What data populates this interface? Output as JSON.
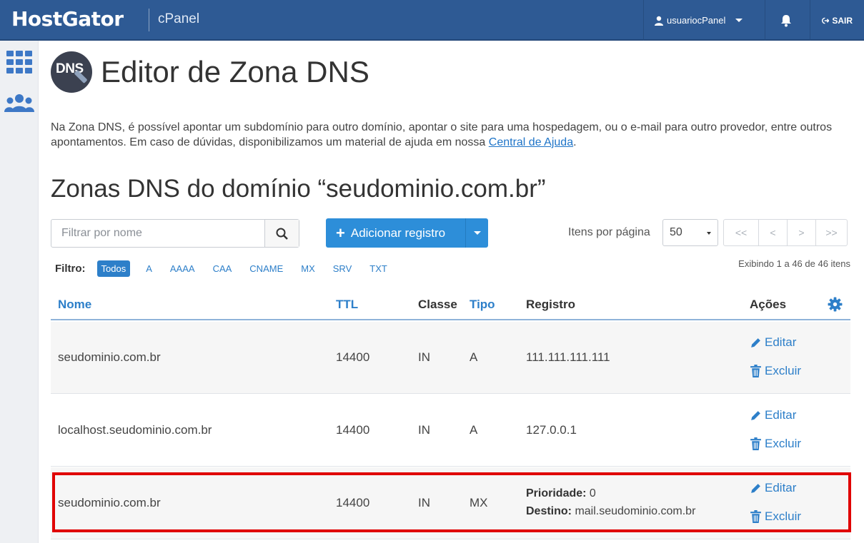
{
  "header": {
    "brand": "HostGator",
    "product": "cPanel",
    "username": "usuariocPanel",
    "logout_label": "SAIR"
  },
  "page": {
    "title": "Editor de Zona DNS",
    "logo_text": "DNS",
    "intro_text": "Na Zona DNS, é possível apontar um subdomínio para outro domínio, apontar o site para uma hospedagem, ou o e-mail para outro provedor, entre outros apontamentos. Em caso de dúvidas, disponibilizamos um material de ajuda em nossa ",
    "intro_link": "Central de Ajuda",
    "intro_end": ".",
    "section_title": "Zonas DNS do domínio “seudominio.com.br”"
  },
  "toolbar": {
    "search_placeholder": "Filtrar por nome",
    "add_button_label": "Adicionar registro",
    "per_page_label": "Itens por página",
    "per_page_value": "50",
    "pager": [
      "<<",
      "<",
      ">",
      ">>"
    ],
    "showing_text": "Exibindo 1 a 46 de 46 itens"
  },
  "filter": {
    "label": "Filtro:",
    "options": [
      "Todos",
      "A",
      "AAAA",
      "CAA",
      "CNAME",
      "MX",
      "SRV",
      "TXT"
    ],
    "active": "Todos"
  },
  "table": {
    "headers": {
      "nome": "Nome",
      "ttl": "TTL",
      "classe": "Classe",
      "tipo": "Tipo",
      "registro": "Registro",
      "acoes": "Ações"
    },
    "edit_label": "Editar",
    "delete_label": "Excluir",
    "rows": [
      {
        "nome": "seudominio.com.br",
        "ttl": "14400",
        "classe": "IN",
        "tipo": "A",
        "registro": "111.111.111.111"
      },
      {
        "nome": "localhost.seudominio.com.br",
        "ttl": "14400",
        "classe": "IN",
        "tipo": "A",
        "registro": "127.0.0.1"
      },
      {
        "nome": "seudominio.com.br",
        "ttl": "14400",
        "classe": "IN",
        "tipo": "MX",
        "prioridade_label": "Prioridade:",
        "prioridade": "0",
        "destino_label": "Destino:",
        "destino": "mail.seudominio.com.br"
      }
    ]
  },
  "colors": {
    "topbar": "#2e5a94",
    "accent": "#2d7fc9",
    "primary_button": "#2d8ed9",
    "highlight": "#e00000"
  }
}
